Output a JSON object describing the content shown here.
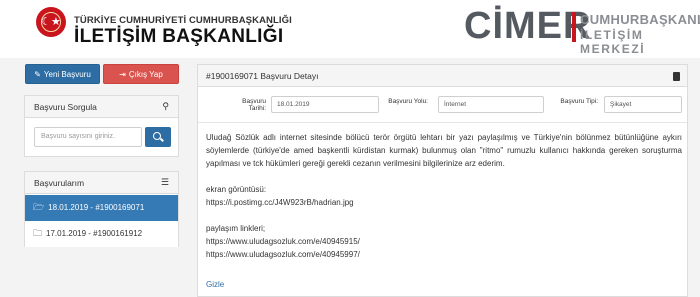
{
  "header": {
    "org_top": "TÜRKİYE CUMHURİYETİ CUMHURBAŞKANLIĞI",
    "org_main": "İLETİŞİM BAŞKANLIĞI",
    "cimer_word": "CİMER",
    "cimer_line1": "CUMHURBAŞKANLIĞI",
    "cimer_line2": "İLETİŞİM MERKEZİ",
    "emblem_icon": "star-crescent-emblem"
  },
  "sidebar": {
    "new_button": "Yeni Başvuru",
    "new_icon": "edit-icon",
    "logout_button": "Çıkış Yap",
    "logout_icon": "sign-out-icon",
    "query": {
      "title": "Başvuru Sorgula",
      "placeholder": "Başvuru sayısını giriniz.",
      "search_icon": "search-icon"
    },
    "applications": {
      "title": "Başvurularım",
      "list_icon": "list-icon",
      "items": [
        {
          "label": "18.01.2019 - #1900169071",
          "active": true,
          "icon": "folder-open-icon"
        },
        {
          "label": "17.01.2019 - #1900161912",
          "active": false,
          "icon": "folder-icon"
        }
      ]
    }
  },
  "detail": {
    "title": "#1900169071 Başvuru Detayı",
    "book_icon": "book-icon",
    "fields": {
      "date_label": "Başvuru Tarihi:",
      "date_value": "18.01.2019",
      "channel_label": "Başvuru Yolu:",
      "channel_value": "İnternet",
      "type_label": "Başvuru Tipi:",
      "type_value": "Şikayet"
    },
    "paragraph": "Uludağ Sözlük adlı internet sitesinde bölücü terör örgütü lehtarı bir yazı paylaşılmış ve Türkiye'nin bölünmez bütünlüğüne aykırı söylemlerde (türkiye'de amed başkentli kürdistan kurmak) bulunmuş olan \"ritmo\" rumuzlu kullanıcı hakkında gereken soruşturma yapılması ve tck hükümleri gereği gerekli cezanın verilmesini bilgilerinize arz ederim.",
    "screenshot_label": "ekran görüntüsü:",
    "screenshot_url": "https://i.postimg.cc/J4W923rB/hadrian.jpg",
    "shares_label": "paylaşım linkleri;",
    "share_url_1": "https://www.uludagsozluk.com/e/40945915/",
    "share_url_2": "https://www.uludagsozluk.com/e/40945997/",
    "hide_link": "Gizle"
  }
}
